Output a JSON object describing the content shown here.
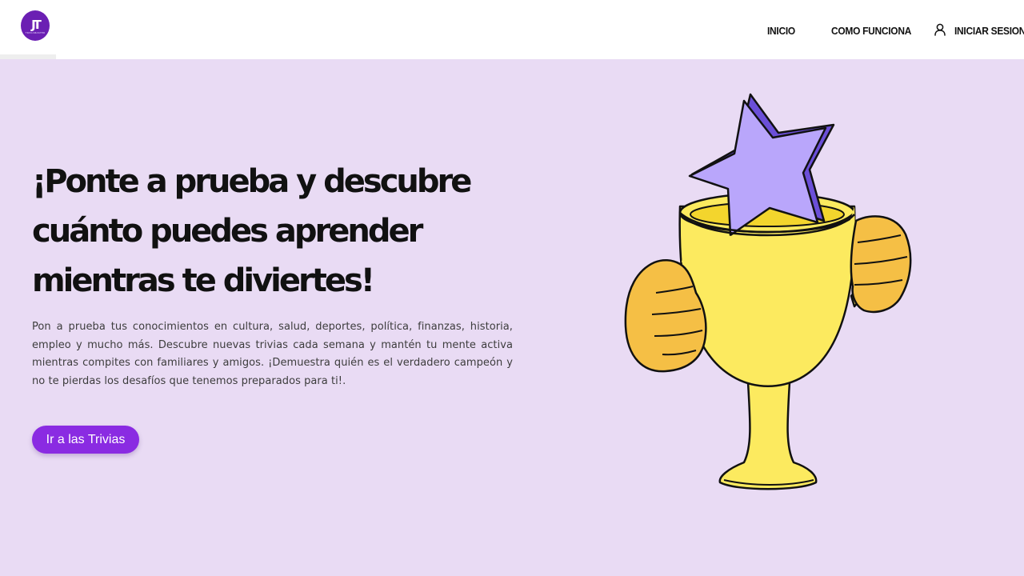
{
  "header": {
    "logo_mark": "JT",
    "logo_sub": "TRIVIAMASTER",
    "nav": {
      "home_label": "INICIO",
      "how_label": "COMO FUNCIONA",
      "login_label": "INICIAR SESION"
    }
  },
  "hero": {
    "title": "¡Ponte a prueba y descubre cuánto puedes aprender mientras te diviertes!",
    "description": "Pon a prueba tus conocimientos en cultura, salud, deportes, política, finanzas, historia, empleo y mucho más. Descubre nuevas trivias cada semana y mantén tu mente activa mientras compites con familiares y amigos. ¡Demuestra quién es el verdadero campeón y no te pierdas los desafíos que tenemos preparados para ti!.",
    "cta_label": "Ir a las Trivias"
  },
  "colors": {
    "page_background": "#e9dbf4",
    "accent": "#8a2be2",
    "logo": "#6b1fb3",
    "trophy": "#fcea5f",
    "hands": "#f5bf45",
    "star": "#b9a6fb"
  },
  "icons": [
    "user-icon",
    "trophy-illustration"
  ]
}
